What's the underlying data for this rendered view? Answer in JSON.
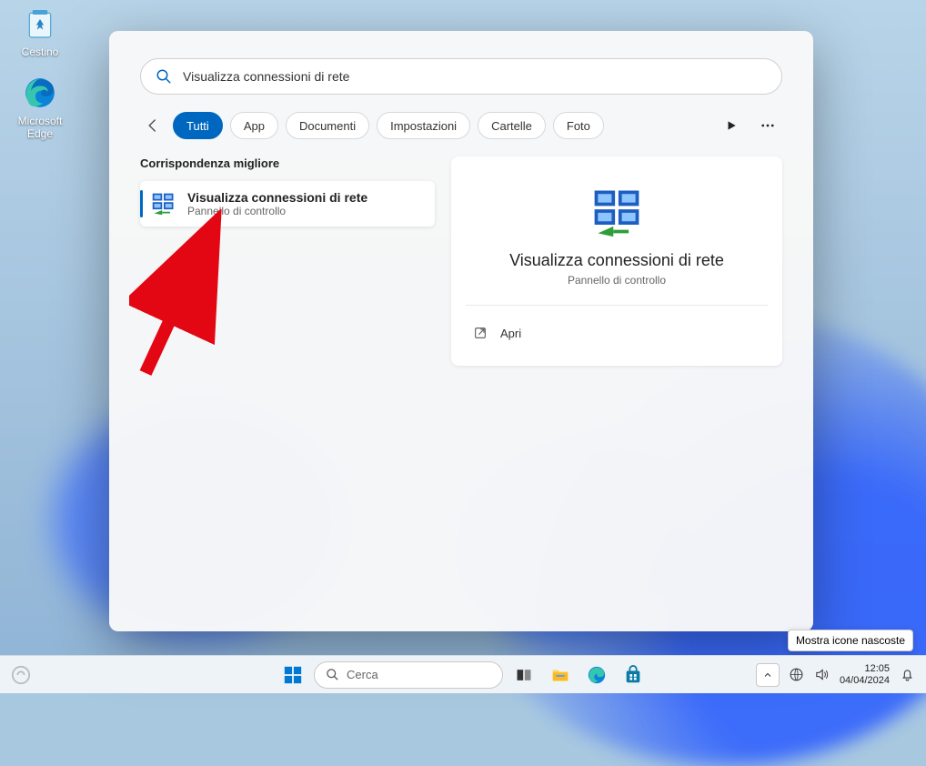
{
  "desktop": {
    "icons": [
      {
        "name": "recycle-bin",
        "label": "Cestino"
      },
      {
        "name": "edge",
        "label": "Microsoft Edge"
      }
    ]
  },
  "search": {
    "query": "Visualizza connessioni di rete"
  },
  "filters": {
    "items": [
      "Tutti",
      "App",
      "Documenti",
      "Impostazioni",
      "Cartelle",
      "Foto"
    ],
    "active": 0
  },
  "results": {
    "section_label": "Corrispondenza migliore",
    "item": {
      "title": "Visualizza connessioni di rete",
      "subtitle": "Pannello di controllo"
    }
  },
  "preview": {
    "title": "Visualizza connessioni di rete",
    "subtitle": "Pannello di controllo",
    "actions": [
      {
        "name": "open",
        "label": "Apri"
      }
    ]
  },
  "tooltip": "Mostra icone nascoste",
  "taskbar": {
    "search_placeholder": "Cerca",
    "time": "12:05",
    "date": "04/04/2024"
  },
  "arrow_color": "#e30613"
}
